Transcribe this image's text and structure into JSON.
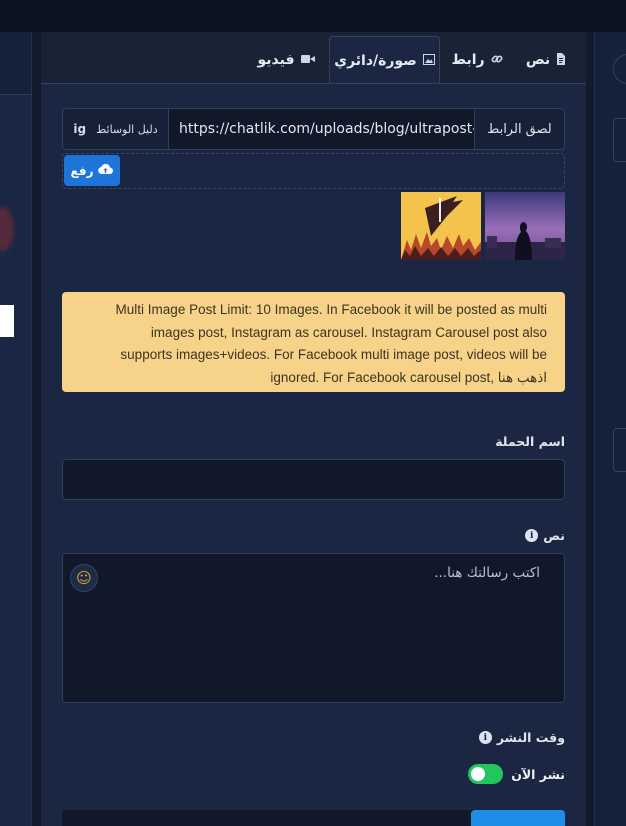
{
  "tabs": [
    {
      "label": "نص",
      "icon": "file-icon"
    },
    {
      "label": "رابط",
      "icon": "link-icon"
    },
    {
      "label": "صورة/دائري",
      "icon": "image-icon",
      "active": true
    },
    {
      "label": "فيديو",
      "icon": "video-icon"
    }
  ],
  "url_row": {
    "media_prefix": "ig",
    "media_label": "دليل الوسائط",
    "url_value": "https://chatlik.com/uploads/blog/ultrapost-",
    "paste_label": "لصق الرابط"
  },
  "upload": {
    "label": "رفع"
  },
  "alert": {
    "lines": [
      "Multi Image Post Limit: 10 Images. In Facebook it will be posted as multi",
      "images post, Instagram as carousel. Instagram Carousel post also",
      "supports images+videos. For Facebook multi image post, videos will be",
      "ignored. For Facebook carousel post, اذهب هنا"
    ]
  },
  "campaign": {
    "label": "اسم الحملة",
    "value": ""
  },
  "message": {
    "label": "نص",
    "placeholder": "اكتب رسالتك هنا..."
  },
  "schedule": {
    "label": "وقت النشر",
    "toggle_label": "نشر الآن",
    "toggle_on": true
  },
  "colors": {
    "accent": "#1f74d9",
    "toggle": "#22c55e",
    "alert_bg": "#f7d38a"
  }
}
